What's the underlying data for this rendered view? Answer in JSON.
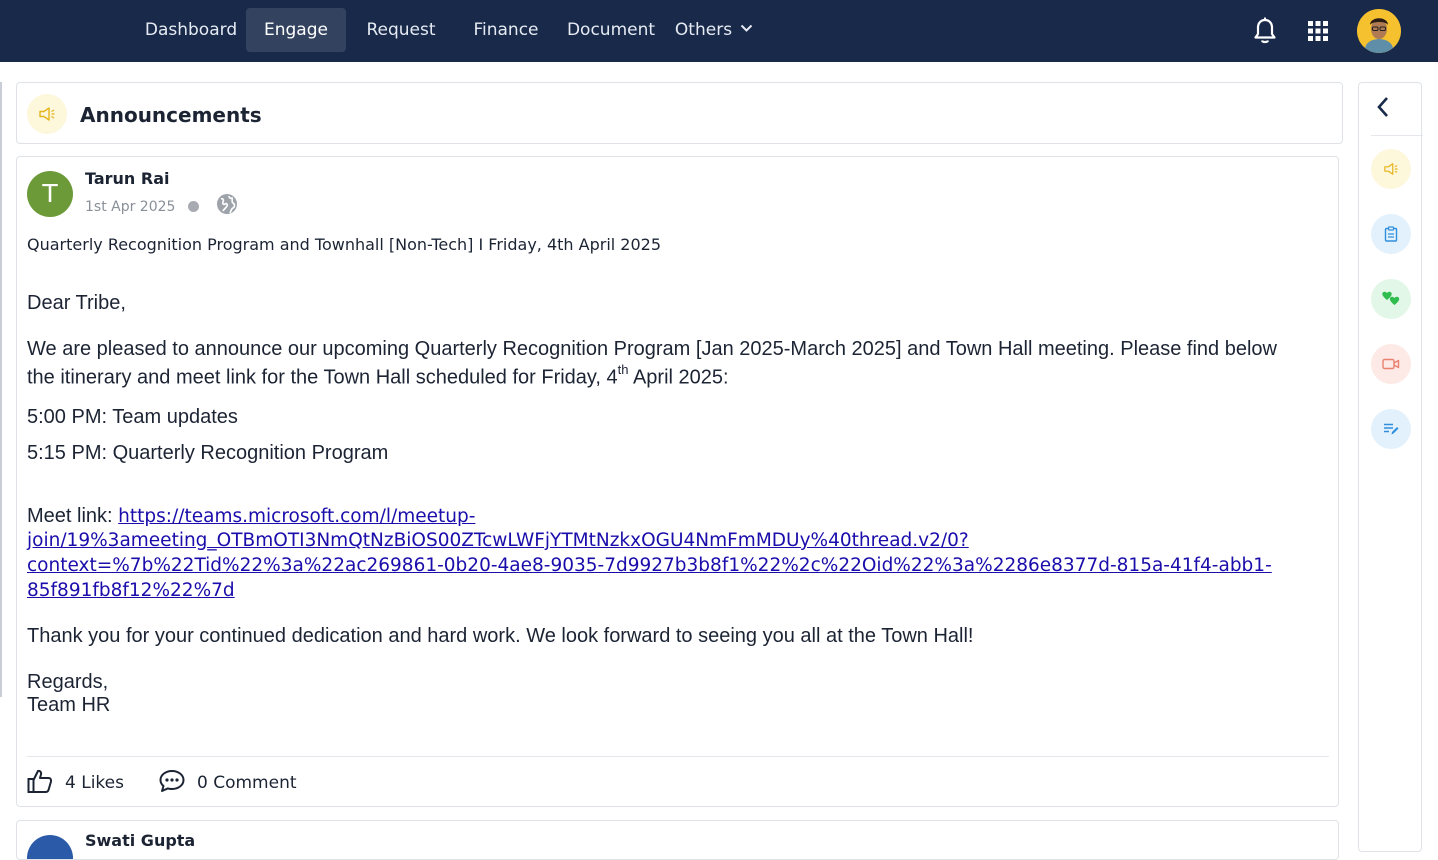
{
  "nav": {
    "items": [
      "Dashboard",
      "Engage",
      "Request",
      "Finance",
      "Document"
    ],
    "others_label": "Others",
    "active": "Engage"
  },
  "top_icons": [
    "bell-icon",
    "apps-grid-icon",
    "user-avatar"
  ],
  "announcements": {
    "title": "Announcements",
    "icon": "megaphone-icon"
  },
  "post": {
    "author": "Tarun Rai",
    "author_initial": "T",
    "date": "1st Apr 2025",
    "visibility_icon": "globe-icon",
    "subject": "Quarterly Recognition Program and Townhall [Non-Tech] I Friday, 4th April 2025",
    "greeting": "Dear Tribe,",
    "intro_line1": "We are pleased to announce our upcoming Quarterly Recognition Program [Jan 2025-March 2025] and Town Hall meeting. Please find below",
    "intro_line2_pre": "the itinerary and meet link for the Town Hall scheduled for Friday, 4",
    "intro_line2_sup": "th",
    "intro_line2_post": " April 2025:",
    "agenda": [
      "5:00 PM: Team updates",
      "5:15 PM: Quarterly Recognition Program"
    ],
    "meet_label": "Meet link: ",
    "meet_link_lines": [
      "https://teams.microsoft.com/l/meetup-",
      "join/19%3ameeting_OTBmOTI3NmQtNzBiOS00ZTcwLWFjYTMtNzkxOGU4NmFmMDUy%40thread.v2/0?",
      "context=%7b%22Tid%22%3a%22ac269861-0b20-4ae8-9035-7d9927b3b8f1%22%2c%22Oid%22%3a%2286e8377d-815a-41f4-abb1-",
      "85f891fb8f12%22%7d"
    ],
    "thanks": "Thank you for your continued dedication and hard work. We look forward to seeing you all at the Town Hall!",
    "regards": "Regards,",
    "signature": "Team HR",
    "likes_label": "4 Likes",
    "comments_label": "0 Comment"
  },
  "next_post": {
    "author": "Swati Gupta"
  },
  "right_panel": {
    "items": [
      {
        "name": "megaphone-icon",
        "bg": "#fdf7dc",
        "color": "#e5b51c"
      },
      {
        "name": "clipboard-icon",
        "bg": "#e3f1fc",
        "color": "#2f8fdc"
      },
      {
        "name": "hearts-icon",
        "bg": "#e3f7e8",
        "color": "#2fbd4e"
      },
      {
        "name": "video-icon",
        "bg": "#fde9e6",
        "color": "#e8826f"
      },
      {
        "name": "edit-list-icon",
        "bg": "#e3f1fc",
        "color": "#2f8fdc"
      }
    ]
  },
  "colors": {
    "nav_bg": "#18294a",
    "nav_active_bg": "#33435f",
    "link": "#1a0dab",
    "avatar_green": "#6c9a38"
  }
}
